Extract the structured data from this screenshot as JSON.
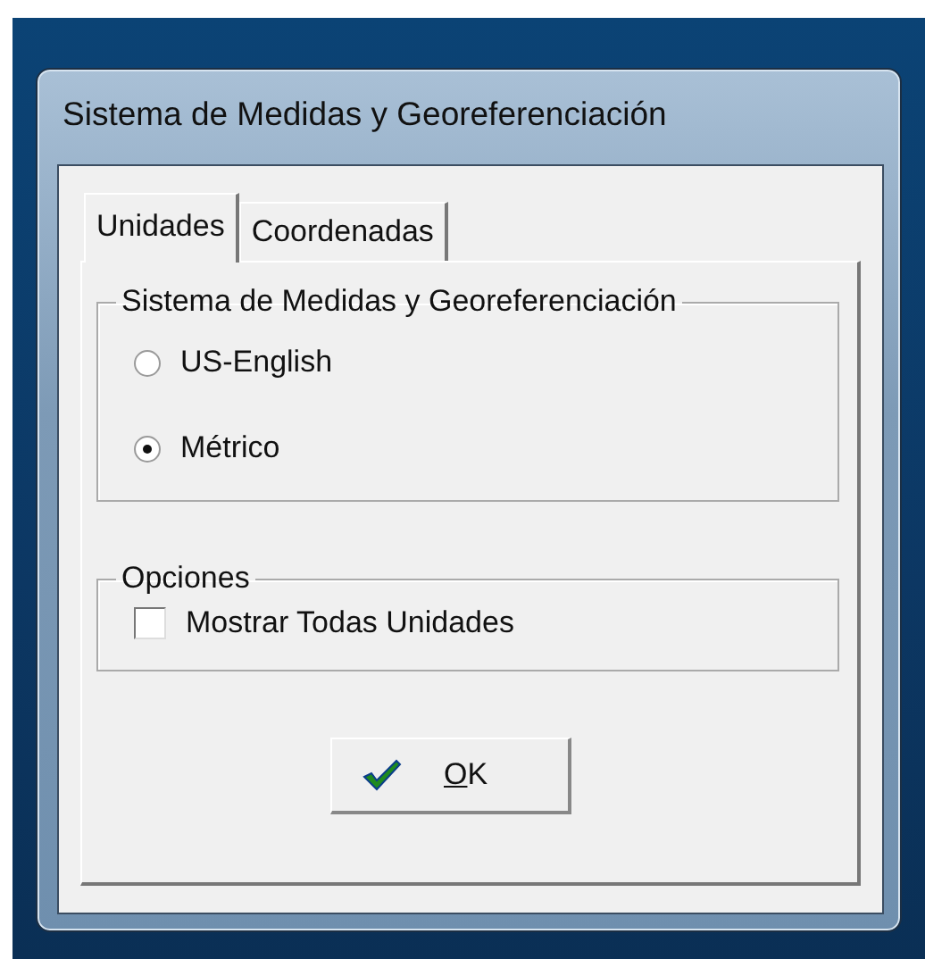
{
  "window": {
    "title": "Sistema de Medidas y Georeferenciación"
  },
  "tabs": [
    {
      "label": "Unidades",
      "selected": true
    },
    {
      "label": "Coordenadas",
      "selected": false
    }
  ],
  "measurement_group": {
    "title": "Sistema de Medidas y Georeferenciación",
    "options": [
      {
        "label": "US-English",
        "selected": false
      },
      {
        "label": "Métrico",
        "selected": true
      }
    ]
  },
  "options_group": {
    "title": "Opciones",
    "checkboxes": [
      {
        "label": "Mostrar Todas Unidades",
        "checked": false
      }
    ]
  },
  "buttons": [
    {
      "label": "OK"
    }
  ]
}
